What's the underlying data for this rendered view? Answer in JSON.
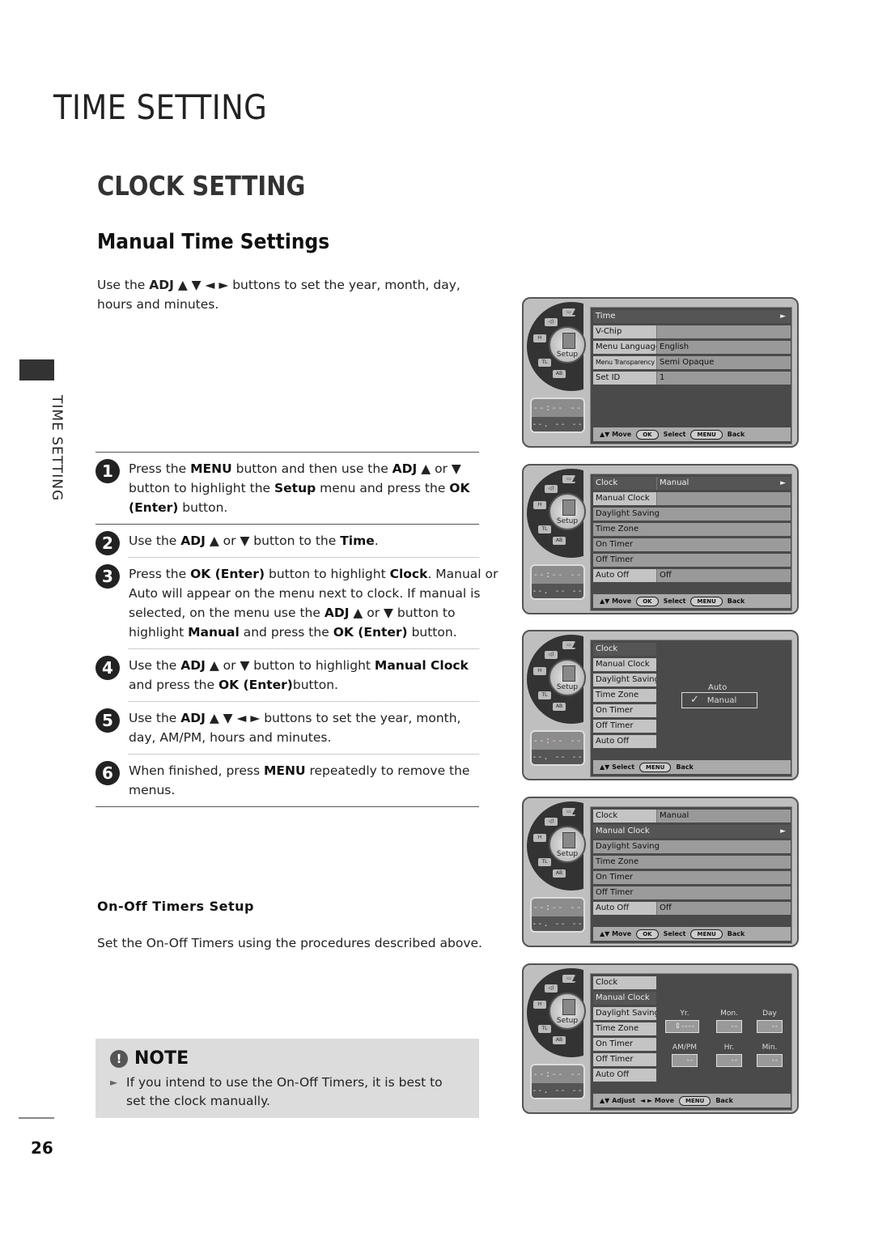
{
  "page": {
    "title": "TIME SETTING",
    "section": "CLOCK SETTING",
    "subtitle": "Manual Time Settings",
    "side_tab": "TIME SETTING",
    "page_number": "26"
  },
  "intro": {
    "pre": "Use the ",
    "adj": "ADJ",
    "arrows": " ▲ ▼ ◄ ► ",
    "post": "buttons to set the year, month, day, hours and minutes."
  },
  "steps": [
    {
      "num": "1",
      "parts": [
        [
          "t",
          "Press the "
        ],
        [
          "b",
          "MENU"
        ],
        [
          "t",
          " button and then use the "
        ],
        [
          "b",
          "ADJ"
        ],
        [
          "t",
          " ▲ or ▼ button to highlight the "
        ],
        [
          "b",
          "Setup"
        ],
        [
          "t",
          " menu and press the "
        ],
        [
          "b",
          "OK (Enter)"
        ],
        [
          "t",
          " button."
        ]
      ]
    },
    {
      "num": "2",
      "parts": [
        [
          "t",
          "Use the "
        ],
        [
          "b",
          "ADJ"
        ],
        [
          "t",
          " ▲ or ▼  button to the "
        ],
        [
          "b",
          "Time"
        ],
        [
          "t",
          "."
        ]
      ]
    },
    {
      "num": "3",
      "parts": [
        [
          "t",
          "Press the "
        ],
        [
          "b",
          "OK (Enter)"
        ],
        [
          "t",
          " button to highlight "
        ],
        [
          "b",
          "Clock"
        ],
        [
          "t",
          ". Manual or Auto will appear on the menu next to clock. If manual is selected, on the menu use the "
        ],
        [
          "b",
          "ADJ"
        ],
        [
          "t",
          " ▲ or ▼ button to highlight "
        ],
        [
          "b",
          "Manual"
        ],
        [
          "t",
          " and press the "
        ],
        [
          "b",
          "OK (Enter)"
        ],
        [
          "t",
          " button."
        ]
      ]
    },
    {
      "num": "4",
      "parts": [
        [
          "t",
          "Use the "
        ],
        [
          "b",
          "ADJ"
        ],
        [
          "t",
          " ▲ or ▼ button to highlight "
        ],
        [
          "b",
          "Manual Clock"
        ],
        [
          "t",
          " and press the "
        ],
        [
          "b",
          "OK (Enter)"
        ],
        [
          "t",
          "button."
        ]
      ]
    },
    {
      "num": "5",
      "parts": [
        [
          "t",
          "Use the "
        ],
        [
          "b",
          "ADJ"
        ],
        [
          "t",
          " ▲ ▼ ◄ ► buttons to set the year, month, day, AM/PM, hours and minutes."
        ]
      ]
    },
    {
      "num": "6",
      "parts": [
        [
          "t",
          "When finished, press "
        ],
        [
          "b",
          "MENU"
        ],
        [
          "t",
          " repeatedly to remove the menus."
        ]
      ]
    }
  ],
  "timers": {
    "title": "On-Off Timers Setup",
    "text": "Set the On-Off Timers using the procedures described above."
  },
  "note": {
    "icon": "!",
    "title": "NOTE",
    "bullet": "►",
    "text": "If you intend to use the On-Off Timers, it is best to set the clock manually."
  },
  "tv_common": {
    "knob_label": "Setup",
    "up": "▲",
    "down": "▼",
    "clock_line1": "--:-- --",
    "clock_line2": "--. -- ----",
    "seg_labels": [
      "▭",
      "◁)",
      "H",
      "TL",
      "AB"
    ]
  },
  "screens": [
    {
      "rows": [
        {
          "k": "Time",
          "v": "",
          "style": "hl full",
          "arrow": "►"
        },
        {
          "k": "V-Chip",
          "v": ""
        },
        {
          "k": "Menu Language",
          "v": "English"
        },
        {
          "k": "Menu Transparency",
          "v": "Semi Opaque",
          "style": "small"
        },
        {
          "k": "Set ID",
          "v": "1"
        }
      ],
      "bar": [
        [
          "t",
          "▲▼ Move"
        ],
        [
          "p",
          "OK"
        ],
        [
          "t",
          "Select"
        ],
        [
          "p",
          "MENU"
        ],
        [
          "t",
          "Back"
        ]
      ]
    },
    {
      "rows": [
        {
          "k": "Clock",
          "v": "Manual",
          "style": "hl",
          "arrow": "►"
        },
        {
          "k": "Manual Clock",
          "v": ""
        },
        {
          "k": "Daylight Saving",
          "v": "",
          "style": "full"
        },
        {
          "k": "Time Zone",
          "v": "",
          "style": "full"
        },
        {
          "k": "On Timer",
          "v": "",
          "style": "full"
        },
        {
          "k": "Off Timer",
          "v": "",
          "style": "full"
        },
        {
          "k": "Auto Off",
          "v": "Off"
        }
      ],
      "bar": [
        [
          "t",
          "▲▼ Move"
        ],
        [
          "p",
          "OK"
        ],
        [
          "t",
          "Select"
        ],
        [
          "p",
          "MENU"
        ],
        [
          "t",
          "Back"
        ]
      ]
    },
    {
      "rows": [
        {
          "k": "Clock",
          "v": "",
          "style": "sub hlk"
        },
        {
          "k": "Manual Clock",
          "v": "",
          "style": "sub"
        },
        {
          "k": "Daylight Saving",
          "v": "",
          "style": "sub"
        },
        {
          "k": "Time Zone",
          "v": "",
          "style": "sub"
        },
        {
          "k": "On Timer",
          "v": "",
          "style": "sub"
        },
        {
          "k": "Off Timer",
          "v": "",
          "style": "sub"
        },
        {
          "k": "Auto Off",
          "v": "",
          "style": "sub"
        }
      ],
      "options": {
        "auto": "Auto",
        "manual": "Manual",
        "check": "✓"
      },
      "bar": [
        [
          "t",
          "▲▼ Select"
        ],
        [
          "p",
          "MENU"
        ],
        [
          "t",
          "Back"
        ]
      ]
    },
    {
      "rows": [
        {
          "k": "Clock",
          "v": "Manual"
        },
        {
          "k": "Manual Clock",
          "v": "",
          "style": "hl full",
          "arrow": "►"
        },
        {
          "k": "Daylight Saving",
          "v": "",
          "style": "full"
        },
        {
          "k": "Time Zone",
          "v": "",
          "style": "full"
        },
        {
          "k": "On Timer",
          "v": "",
          "style": "full"
        },
        {
          "k": "Off Timer",
          "v": "",
          "style": "full"
        },
        {
          "k": "Auto Off",
          "v": "Off"
        }
      ],
      "bar": [
        [
          "t",
          "▲▼ Move"
        ],
        [
          "p",
          "OK"
        ],
        [
          "t",
          "Select"
        ],
        [
          "p",
          "MENU"
        ],
        [
          "t",
          "Back"
        ]
      ]
    },
    {
      "rows": [
        {
          "k": "Clock",
          "v": "",
          "style": "sub"
        },
        {
          "k": "Manual Clock",
          "v": "",
          "style": "sub hlk"
        },
        {
          "k": "Daylight Saving",
          "v": "",
          "style": "sub"
        },
        {
          "k": "Time Zone",
          "v": "",
          "style": "sub"
        },
        {
          "k": "On Timer",
          "v": "",
          "style": "sub"
        },
        {
          "k": "Off Timer",
          "v": "",
          "style": "sub"
        },
        {
          "k": "Auto Off",
          "v": "",
          "style": "sub"
        }
      ],
      "fields": [
        {
          "label": "Yr.",
          "value": "⇕----"
        },
        {
          "label": "Mon.",
          "value": "--"
        },
        {
          "label": "Day",
          "value": "--"
        },
        {
          "label": "AM/PM",
          "value": "--"
        },
        {
          "label": "Hr.",
          "value": "--"
        },
        {
          "label": "Min.",
          "value": "--"
        }
      ],
      "bar": [
        [
          "t",
          "▲▼ Adjust"
        ],
        [
          "t",
          "◄ ► Move"
        ],
        [
          "p",
          "MENU"
        ],
        [
          "t",
          "Back"
        ]
      ]
    }
  ]
}
